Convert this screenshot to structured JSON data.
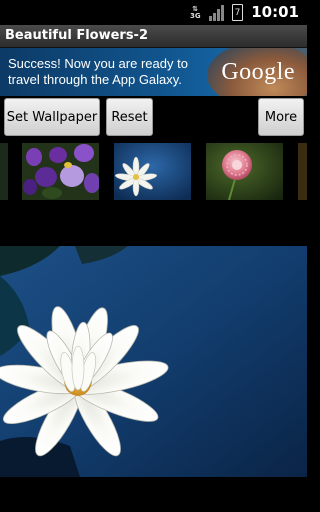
{
  "status_bar": {
    "network": "3G",
    "battery_level": "7",
    "time": "10:01"
  },
  "app": {
    "title": "Beautiful Flowers-2"
  },
  "ad": {
    "line1": "Success! Now you are ready to",
    "line2": "travel through the App Galaxy.",
    "brand": "Google"
  },
  "buttons": {
    "set_wallpaper": "Set Wallpaper",
    "reset": "Reset",
    "more": "More"
  },
  "thumbnails": [
    "purple-crocus-flowers",
    "white-water-lily",
    "pink-dahlia-flower"
  ],
  "preview": {
    "image": "white-water-lily-on-blue-water"
  }
}
